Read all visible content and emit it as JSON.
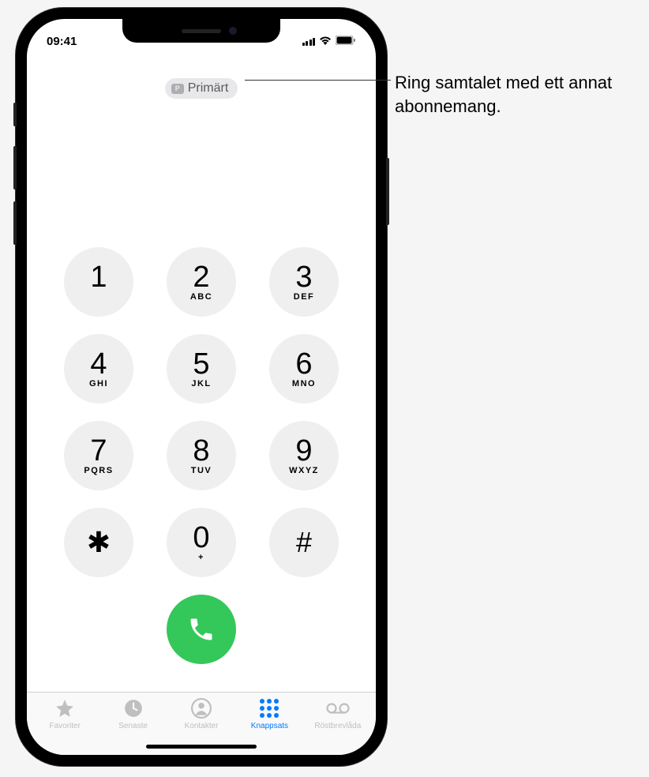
{
  "status": {
    "time": "09:41"
  },
  "sim": {
    "badge": "P",
    "label": "Primärt"
  },
  "keypad": [
    {
      "digit": "1",
      "letters": ""
    },
    {
      "digit": "2",
      "letters": "ABC"
    },
    {
      "digit": "3",
      "letters": "DEF"
    },
    {
      "digit": "4",
      "letters": "GHI"
    },
    {
      "digit": "5",
      "letters": "JKL"
    },
    {
      "digit": "6",
      "letters": "MNO"
    },
    {
      "digit": "7",
      "letters": "PQRS"
    },
    {
      "digit": "8",
      "letters": "TUV"
    },
    {
      "digit": "9",
      "letters": "WXYZ"
    },
    {
      "digit": "✱",
      "letters": ""
    },
    {
      "digit": "0",
      "letters": "+"
    },
    {
      "digit": "#",
      "letters": ""
    }
  ],
  "tabs": [
    {
      "label": "Favoriter"
    },
    {
      "label": "Senaste"
    },
    {
      "label": "Kontakter"
    },
    {
      "label": "Knappsats"
    },
    {
      "label": "Röstbrevlåda"
    }
  ],
  "callout": {
    "text": "Ring samtalet med ett annat abonnemang."
  }
}
